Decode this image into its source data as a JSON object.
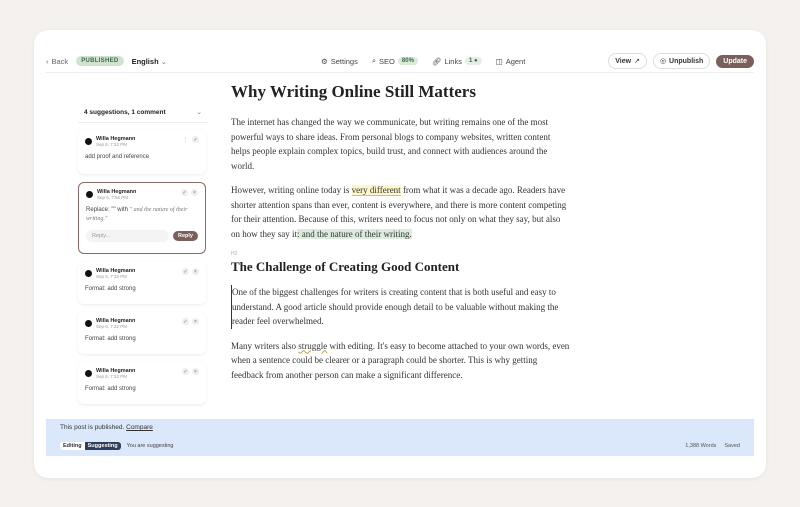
{
  "toolbar": {
    "back_label": "Back",
    "status_badge": "PUBLISHED",
    "language": "English",
    "settings_label": "Settings",
    "seo_label": "SEO",
    "seo_score": "80%",
    "links_label": "Links",
    "links_count": "1",
    "agent_label": "Agent",
    "view_label": "View",
    "unpublish_label": "Unpublish",
    "update_label": "Update"
  },
  "comments": {
    "header": "4 suggestions, 1 comment",
    "items": [
      {
        "name": "Willa Hegmann",
        "date": "Sep 6, 7:32 PM",
        "body": "add proof and reference"
      },
      {
        "name": "Willa Hegmann",
        "date": "Sep 6, 7:56 PM",
        "body_prefix": "Replace: \"\" with",
        "body_quote": "\" and the nature of their writing.\"",
        "reply_placeholder": "Reply...",
        "reply_label": "Reply"
      },
      {
        "name": "Willa Hegmann",
        "date": "Sep 6, 7:32 PM",
        "body": "Format: add strong"
      },
      {
        "name": "Willa Hegmann",
        "date": "Sep 6, 7:32 PM",
        "body": "Format: add strong"
      },
      {
        "name": "Willa Hegmann",
        "date": "Sep 6, 7:32 PM",
        "body": "Format: add strong"
      }
    ]
  },
  "article": {
    "title": "Why Writing Online Still Matters",
    "p1": "The internet has changed the way we communicate, but writing remains one of the most powerful ways to share ideas. From personal blogs to company websites, written content helps people explain complex topics, build trust, and connect with audiences around the world.",
    "p2_a": "However, writing online today is ",
    "p2_hl": "very different",
    "p2_b": " from what it was a decade ago. Readers have shorter attention spans than ever, content is everywhere, and there is more content competing for their attention. Because of this, writers need to focus not only on what they say, but also on how they say it",
    "p2_ins": ": and the nature of their writing.",
    "h2_tag": "H2",
    "h2": "The Challenge of Creating Good Content",
    "p3": "One of the biggest challenges for writers is creating content that is both useful and easy to understand. A good article should provide enough detail to be valuable without making the reader feel overwhelmed.",
    "p4_a": "Many writers also ",
    "p4_wavy": "struggle",
    "p4_b": " with editing. It's easy to become attached to your own words, even when a sentence could be clearer or a paragraph could be shorter. This is why getting feedback from another person can make a significant difference."
  },
  "status": {
    "published_text": "This post is published.",
    "compare_label": "Compare",
    "mode_editing": "Editing",
    "mode_suggesting": "Suggesting",
    "suggesting_note": "You are suggesting",
    "word_count": "1,388 Words",
    "saved": "Saved"
  },
  "icons": {
    "back": "chevron-left-icon",
    "language": "chevron-down-icon",
    "settings": "gear-icon",
    "seo": "search-icon",
    "links": "link-icon",
    "agent": "robot-icon",
    "view": "external-link-icon",
    "unpublish": "eye-off-icon"
  },
  "colors": {
    "accent": "#7a5f5b",
    "published_badge": "#cfe3cf",
    "status_bar": "#dbe7fb",
    "suggest_mode": "#2e3e5c"
  }
}
